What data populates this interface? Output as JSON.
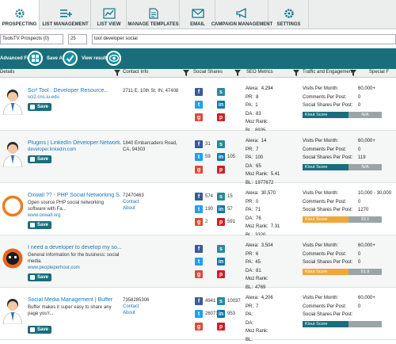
{
  "tabs": [
    {
      "label": "PROSPECTING",
      "icon": "gear-icon",
      "active": true
    },
    {
      "label": "LIST MANAGEMENT",
      "icon": "list-plus-icon"
    },
    {
      "label": "LIST VIEW",
      "icon": "chart-icon"
    },
    {
      "label": "MANAGE TEMPLATES",
      "icon": "document-icon"
    },
    {
      "label": "EMAIL",
      "icon": "envelope-icon"
    },
    {
      "label": "CAMPAIGN MANAGEMENT",
      "icon": "megaphone-icon"
    },
    {
      "label": "SETTINGS",
      "icon": "settings-icon"
    }
  ],
  "filters": {
    "prospects_select": "ToolsTV Prospects (0)",
    "page_size": "25",
    "search_value": "tool developer social"
  },
  "toolbar": {
    "advanced_filters": "Advanced Filters",
    "save_all": "Save All",
    "view_results": "View results"
  },
  "columns": {
    "details": "Details",
    "contact": "Contact Info",
    "social": "Social Shares",
    "seo": "SEO Metrics",
    "traffic": "Traffic and Engagement",
    "special": "Special F"
  },
  "labels": {
    "save": "Save",
    "alexa": "Alexa:",
    "pr": "PR:",
    "pa": "PA:",
    "da": "DA:",
    "moz": "Moz Rank:",
    "bl": "BL:",
    "visits": "Visits Per Month:",
    "comments": "Comments Per Post:",
    "shares": "Social Shares Per Post:",
    "klout": "Klout Score",
    "contact_us": "Contact",
    "about": "About"
  },
  "rows": [
    {
      "title": "Sci² Tool : Developer Resource...",
      "desc": "",
      "url": "sci2.cns.iu.edu",
      "contact": "2711 E. 10th St. IN, 47408",
      "fb": "",
      "tw": "",
      "gp": "",
      "li": "",
      "tw2": "",
      "pin": "",
      "seo": {
        "alexa": "4,294",
        "pr": "8",
        "pa": "1",
        "da": "83",
        "moz": "",
        "bl": "8935"
      },
      "traffic": {
        "visits": "60,000+",
        "comments": "0",
        "shares": "0",
        "klout": "N/A",
        "klout_color": "#1a6e7c"
      }
    },
    {
      "title": "Plugins | LinkedIn Developer Network...",
      "desc": "",
      "url": "developer.linkedin.com",
      "contact": "1840 Embarcadero Road, CA, 94303",
      "fb": "31",
      "tw": "59",
      "gp": "",
      "li": "105",
      "tw2": "",
      "pin": "",
      "seo": {
        "alexa": "14",
        "pr": "7",
        "pa": "100",
        "da": "65",
        "moz": "5.41",
        "bl": "1977672"
      },
      "traffic": {
        "visits": "60,000+",
        "comments": "0",
        "shares": "119",
        "klout": "N/A",
        "klout_color": "#1a6e7c"
      }
    },
    {
      "title": "Oxwall ?? - PHP Social Networking S...",
      "desc": "Open source PHP social networking software with Fa...",
      "url": "www.oxwall.org",
      "contact": "72470463",
      "fb": "574",
      "tw": "190",
      "gp": "2",
      "li": "57",
      "tw2": "15",
      "pin": "591",
      "seo": {
        "alexa": "30,570",
        "pr": "0",
        "pa": "71",
        "da": "76",
        "moz": "7.31",
        "bl": "3320"
      },
      "traffic": {
        "visits": "10,000 - 30,000",
        "comments": "0",
        "shares": "1270",
        "klout": "33.1",
        "klout_color": "#f0a63a"
      }
    },
    {
      "title": "I need a developer to develop my so...",
      "desc": "General information for the business: social media.",
      "url": "www.peopleperhour.com",
      "contact": "",
      "fb": "",
      "tw": "",
      "gp": "",
      "li": "",
      "tw2": "",
      "pin": "",
      "seo": {
        "alexa": "3,504",
        "pr": "6",
        "pa": "45",
        "da": "81",
        "moz": "",
        "bl": "4769"
      },
      "traffic": {
        "visits": "60,000+",
        "comments": "0",
        "shares": "0",
        "klout": "51.9",
        "klout_color": "#f0a63a"
      }
    },
    {
      "title": "Social Media Management | Buffer",
      "desc": "Buffer makes it super easy to share any page you'r...",
      "url": "",
      "contact": "7358285306",
      "fb": "4941",
      "tw": "26071",
      "gp": "",
      "li": "953",
      "tw2": "10037",
      "pin": "",
      "seo": {
        "alexa": "4,206",
        "pr": "7",
        "pa": "",
        "da": "",
        "moz": "",
        "bl": ""
      },
      "traffic": {
        "visits": "60,000+",
        "comments": "0",
        "shares": "",
        "klout": "",
        "klout_color": "#1a6e7c"
      }
    }
  ]
}
